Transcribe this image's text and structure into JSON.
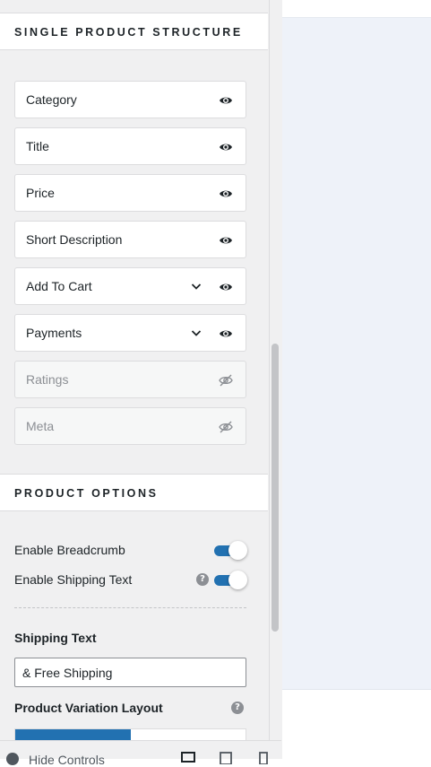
{
  "sections": {
    "structure_title": "Single Product Structure",
    "options_title": "Product Options"
  },
  "structure_items": [
    {
      "label": "Category",
      "visible": true,
      "expandable": false
    },
    {
      "label": "Title",
      "visible": true,
      "expandable": false
    },
    {
      "label": "Price",
      "visible": true,
      "expandable": false
    },
    {
      "label": "Short Description",
      "visible": true,
      "expandable": false
    },
    {
      "label": "Add To Cart",
      "visible": true,
      "expandable": true
    },
    {
      "label": "Payments",
      "visible": true,
      "expandable": true
    },
    {
      "label": "Ratings",
      "visible": false,
      "expandable": false
    },
    {
      "label": "Meta",
      "visible": false,
      "expandable": false
    }
  ],
  "options": {
    "breadcrumb_label": "Enable Breadcrumb",
    "breadcrumb_on": true,
    "shipping_text_label": "Enable Shipping Text",
    "shipping_text_on": true,
    "shipping_text_help": "?",
    "shipping_field_title": "Shipping Text",
    "shipping_field_value": "& Free Shipping",
    "variation_layout_title": "Product Variation Layout",
    "variation_layout_help": "?"
  },
  "footer": {
    "hide_controls_label": "Hide Controls",
    "devices": [
      "desktop-icon",
      "tablet-icon",
      "mobile-icon"
    ]
  },
  "colors": {
    "accent": "#2271b1",
    "panel_bg": "#f0f0f1",
    "preview_bg": "#eef2f9"
  }
}
